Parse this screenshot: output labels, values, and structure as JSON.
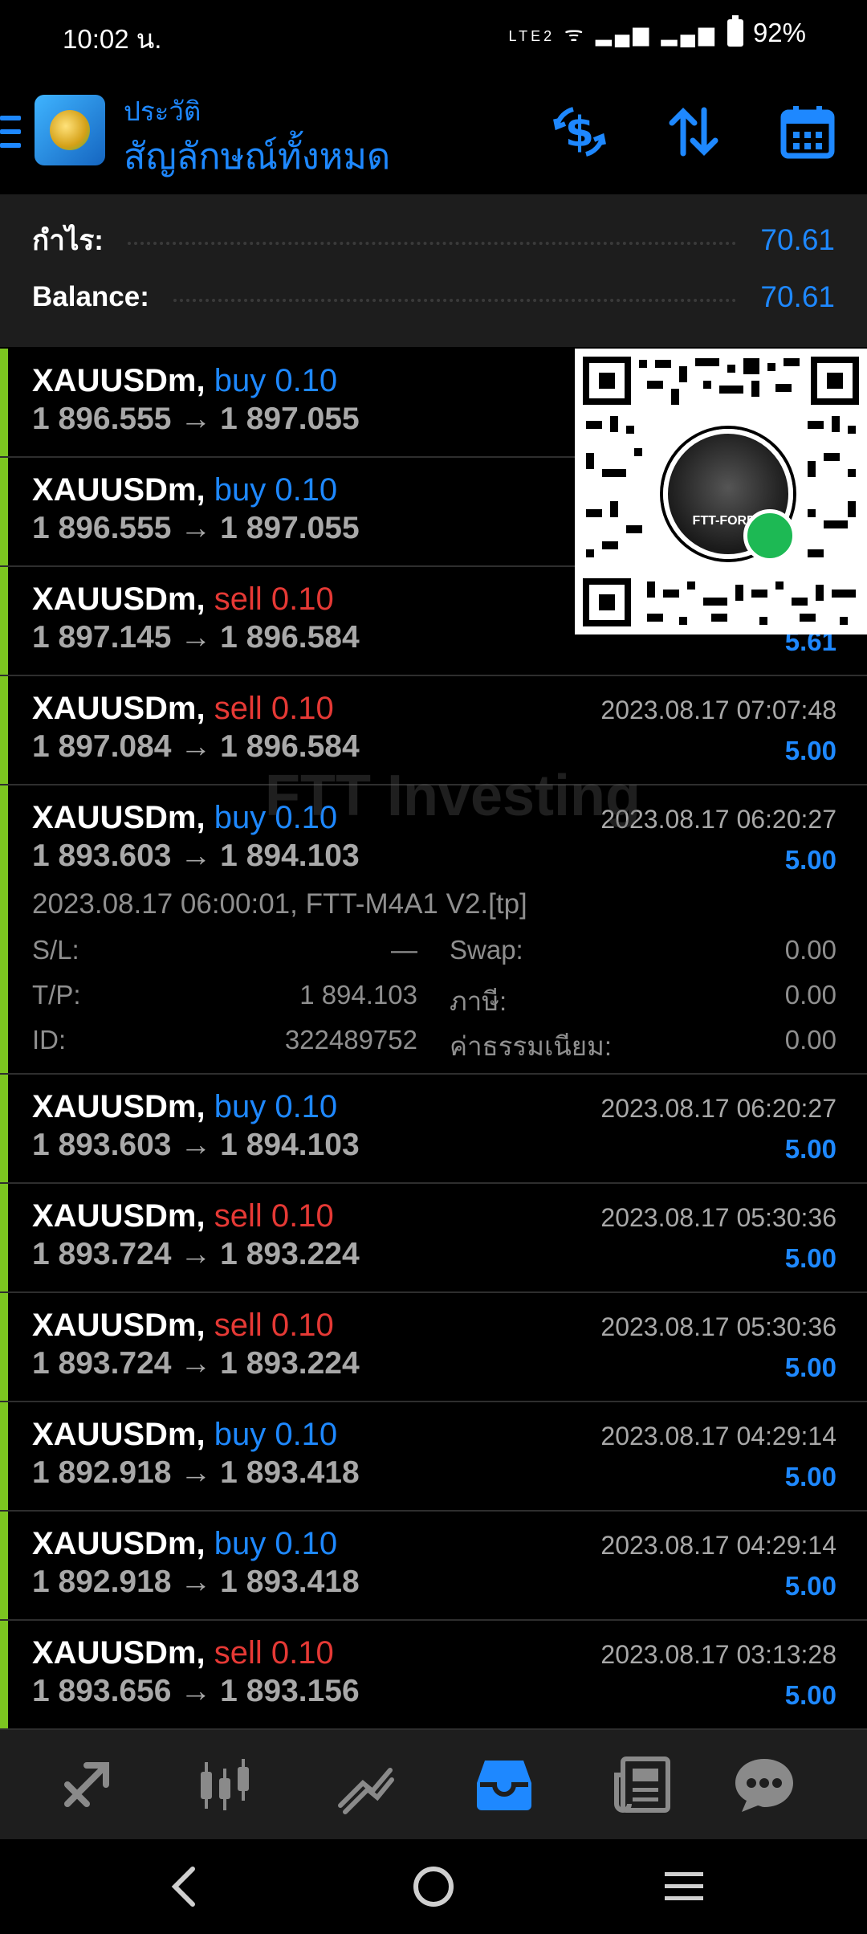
{
  "status_bar": {
    "time": "10:02 น.",
    "battery": "92%",
    "network_label": "LTE2"
  },
  "app_bar": {
    "subtitle": "ประวัติ",
    "title": "สัญลักษณ์ทั้งหมด",
    "icons": [
      "menu-icon",
      "app-logo",
      "currency-exchange-icon",
      "sort-icon",
      "calendar-icon"
    ],
    "accent_color": "#1e88ff"
  },
  "summary": {
    "profit_label": "กำไร:",
    "profit_value": "70.61",
    "balance_label": "Balance:",
    "balance_value": "70.61"
  },
  "deals": [
    {
      "symbol": "XAUUSDm,",
      "type": "buy 0.10",
      "side": "buy",
      "prices": "1 896.555 → 1 897.055",
      "time": "",
      "profit": ""
    },
    {
      "symbol": "XAUUSDm,",
      "type": "buy 0.10",
      "side": "buy",
      "prices": "1 896.555 → 1 897.055",
      "time": "",
      "profit": ""
    },
    {
      "symbol": "XAUUSDm,",
      "type": "sell 0.10",
      "side": "sell",
      "prices": "1 897.145 → 1 896.584",
      "time": "",
      "profit": "5.61"
    },
    {
      "symbol": "XAUUSDm,",
      "type": "sell 0.10",
      "side": "sell",
      "prices": "1 897.084 → 1 896.584",
      "time": "2023.08.17 07:07:48",
      "profit": "5.00"
    },
    {
      "symbol": "XAUUSDm,",
      "type": "buy 0.10",
      "side": "buy",
      "prices": "1 893.603 → 1 894.103",
      "time": "2023.08.17 06:20:27",
      "profit": "5.00"
    },
    {
      "symbol": "XAUUSDm,",
      "type": "buy 0.10",
      "side": "buy",
      "prices": "1 893.603 → 1 894.103",
      "time": "2023.08.17 06:20:27",
      "profit": "5.00"
    },
    {
      "symbol": "XAUUSDm,",
      "type": "sell 0.10",
      "side": "sell",
      "prices": "1 893.724 → 1 893.224",
      "time": "2023.08.17 05:30:36",
      "profit": "5.00"
    },
    {
      "symbol": "XAUUSDm,",
      "type": "sell 0.10",
      "side": "sell",
      "prices": "1 893.724 → 1 893.224",
      "time": "2023.08.17 05:30:36",
      "profit": "5.00"
    },
    {
      "symbol": "XAUUSDm,",
      "type": "buy 0.10",
      "side": "buy",
      "prices": "1 892.918 → 1 893.418",
      "time": "2023.08.17 04:29:14",
      "profit": "5.00"
    },
    {
      "symbol": "XAUUSDm,",
      "type": "buy 0.10",
      "side": "buy",
      "prices": "1 892.918 → 1 893.418",
      "time": "2023.08.17 04:29:14",
      "profit": "5.00"
    },
    {
      "symbol": "XAUUSDm,",
      "type": "sell 0.10",
      "side": "sell",
      "prices": "1 893.656 → 1 893.156",
      "time": "2023.08.17 03:13:28",
      "profit": "5.00"
    }
  ],
  "expanded_detail": {
    "open_info": "2023.08.17 06:00:01, FTT-M4A1 V2.[tp]",
    "sl_label": "S/L:",
    "sl_value": "—",
    "tp_label": "T/P:",
    "tp_value": "1 894.103",
    "id_label": "ID:",
    "id_value": "322489752",
    "swap_label": "Swap:",
    "swap_value": "0.00",
    "tax_label": "ภาษี:",
    "tax_value": "0.00",
    "commission_label": "ค่าธรรมเนียม:",
    "commission_value": "0.00"
  },
  "watermark": {
    "text": "FTT Investing"
  },
  "qr_overlay": {
    "center_label": "FTT-FOREX"
  },
  "bottom_nav": {
    "items": [
      "trade-icon",
      "chart-icon",
      "trend-icon",
      "history-icon",
      "news-icon",
      "chat-icon"
    ],
    "active": "history-icon"
  },
  "colors": {
    "buy": "#1e88ff",
    "sell": "#e53935",
    "profit_bar": "#7cc520",
    "background": "#000000"
  }
}
